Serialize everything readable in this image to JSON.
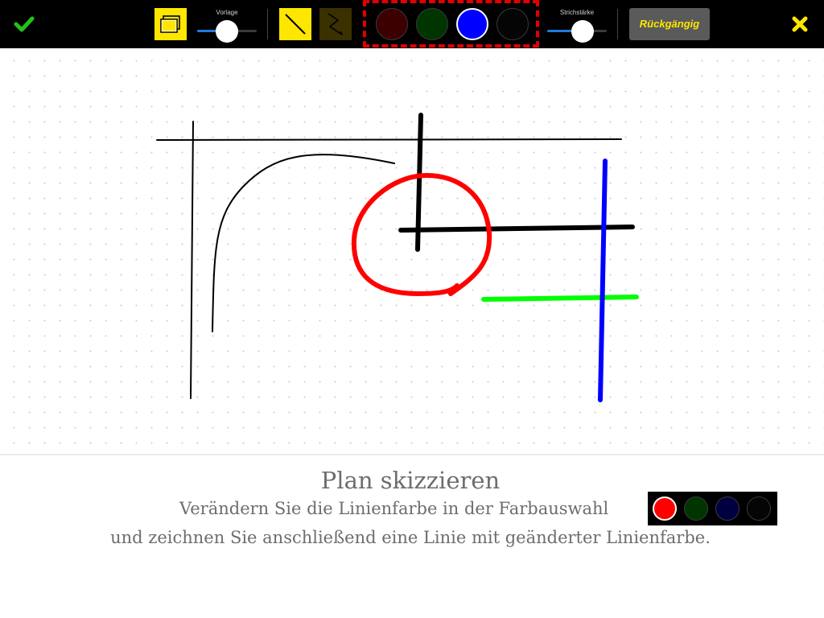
{
  "toolbar": {
    "confirm_icon": "checkmark-icon",
    "template_icon": "layers-icon",
    "template_slider": {
      "label": "Vorlage",
      "value": 0.5
    },
    "tool_straight_icon": "straight-line-icon",
    "tool_freehand_icon": "freehand-line-icon",
    "colors": [
      {
        "name": "red",
        "hex": "#3d0000",
        "selected": false
      },
      {
        "name": "green",
        "hex": "#003500",
        "selected": false
      },
      {
        "name": "blue",
        "hex": "#0000ff",
        "selected": true
      },
      {
        "name": "black",
        "hex": "#050505",
        "selected": false
      }
    ],
    "stroke_slider": {
      "label": "Strichstärke",
      "value": 0.6
    },
    "undo_label": "Rückgängig",
    "close_icon": "close-icon",
    "accent": "#ffe600",
    "highlight_dash": "#e00000"
  },
  "canvas": {
    "grid": "dotted",
    "strokes": [
      {
        "color": "#000000",
        "width": 2
      },
      {
        "color": "#000000",
        "width": 2
      },
      {
        "color": "#000000",
        "width": 2
      },
      {
        "color": "#000000",
        "width": 6
      },
      {
        "color": "#000000",
        "width": 6
      },
      {
        "color": "#ff0000",
        "width": 6
      },
      {
        "color": "#00ff00",
        "width": 6
      },
      {
        "color": "#0000ff",
        "width": 6
      }
    ]
  },
  "instructions": {
    "title": "Plan skizzieren",
    "line1": "Verändern Sie die Linienfarbe in der Farbauswahl",
    "line2": "und zeichnen Sie anschließend eine Linie mit geänderter Linienfarbe.",
    "palette": [
      {
        "name": "red",
        "hex": "#ff0000",
        "selected": true
      },
      {
        "name": "green",
        "hex": "#003500",
        "selected": false
      },
      {
        "name": "blue",
        "hex": "#000040",
        "selected": false
      },
      {
        "name": "black",
        "hex": "#050505",
        "selected": false
      }
    ]
  }
}
